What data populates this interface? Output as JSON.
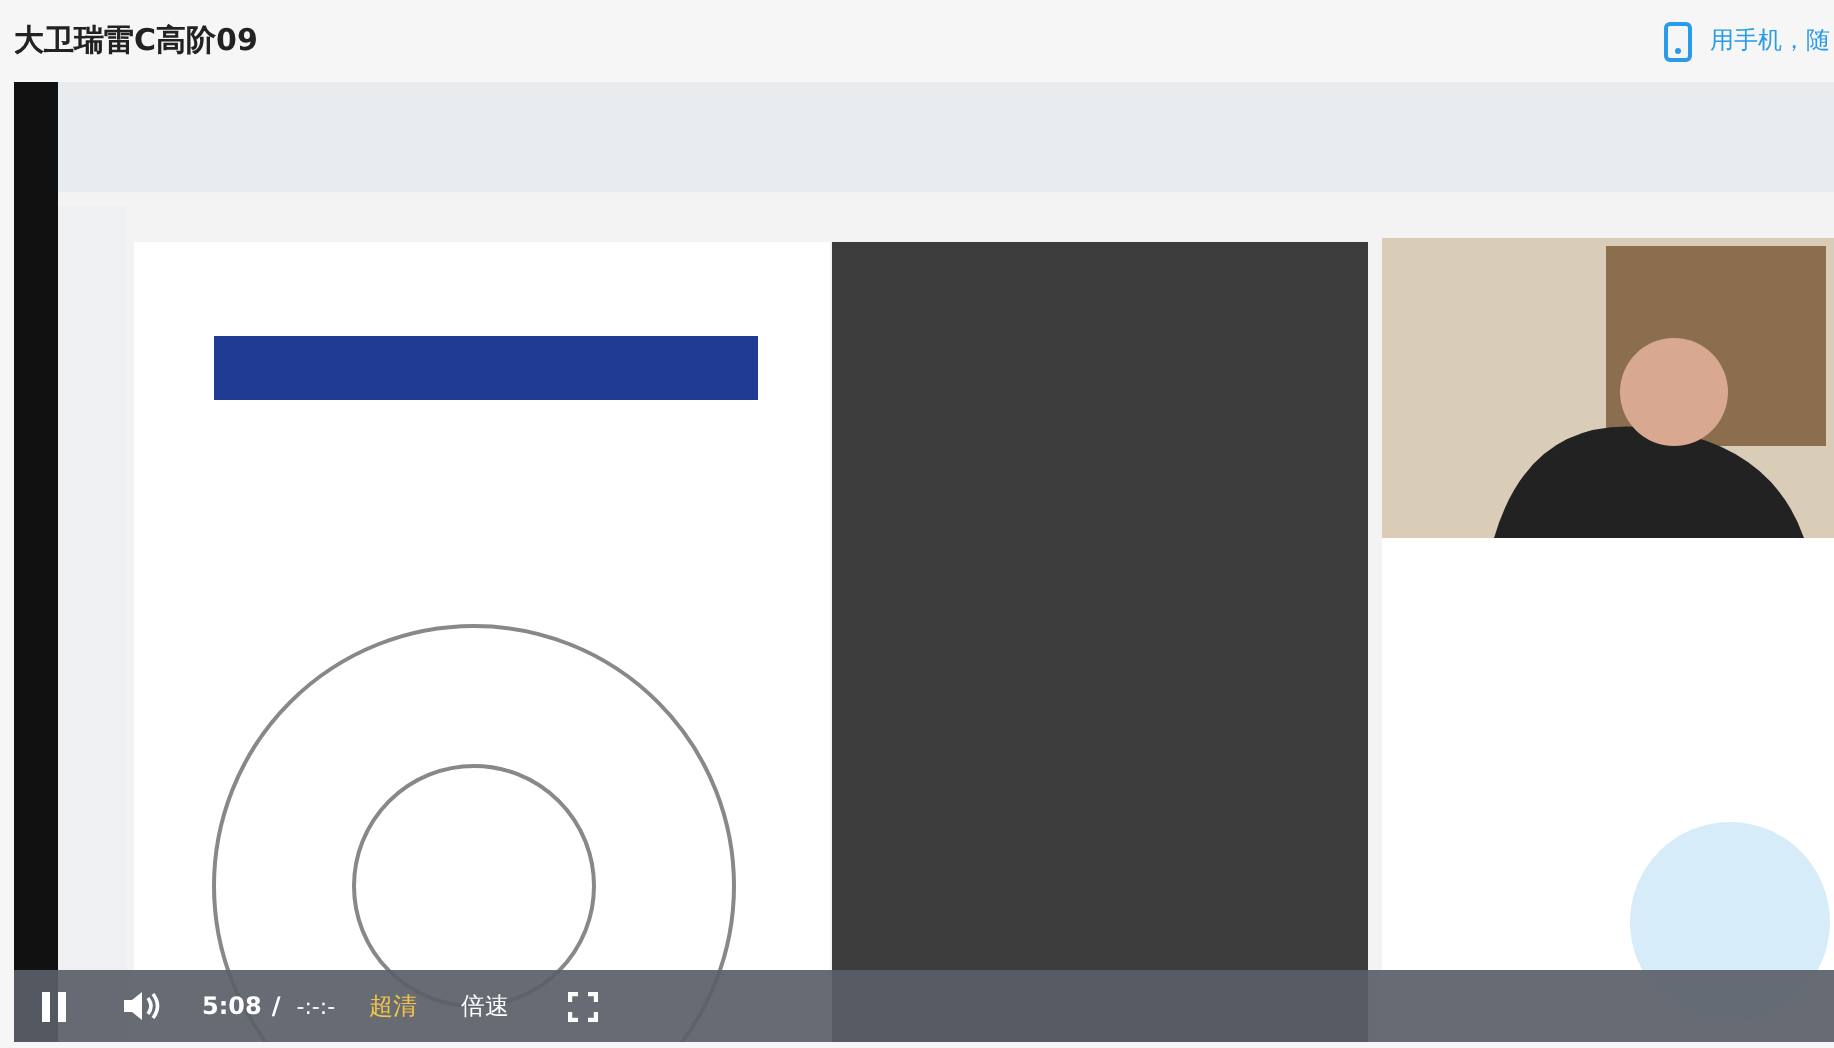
{
  "header": {
    "title": "大卫瑞雷C高阶09",
    "phone_link": "用手机，随"
  },
  "player": {
    "controls": {
      "playing": true,
      "current_time": "5:08",
      "separator": "/",
      "duration": "-:-:-",
      "quality": "超清",
      "speed": "倍速"
    }
  }
}
